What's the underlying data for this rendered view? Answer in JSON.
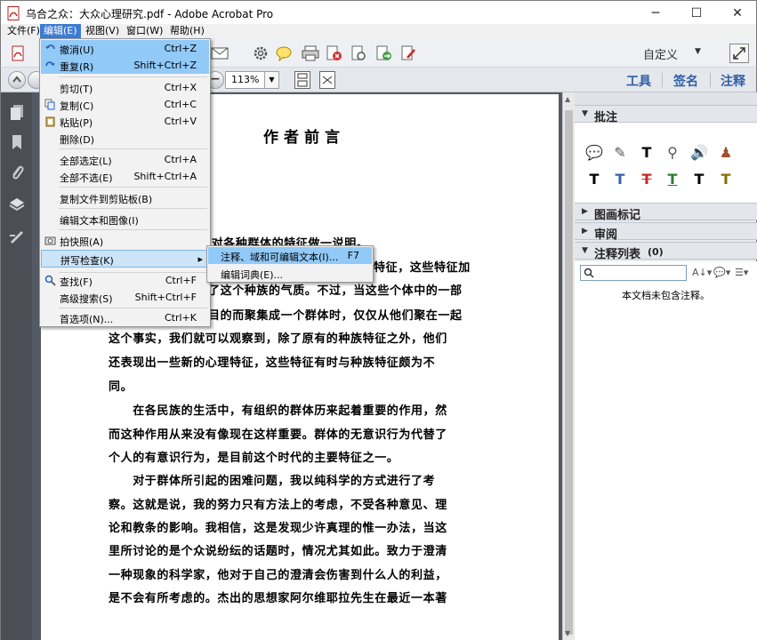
{
  "window": {
    "title": "乌合之众：大众心理研究.pdf - Adobe Acrobat Pro",
    "minimize": "─",
    "maximize": "☐",
    "close": "✕"
  },
  "menubar": {
    "items": [
      {
        "label": "文件(F)"
      },
      {
        "label": "编辑(E)"
      },
      {
        "label": "视图(V)"
      },
      {
        "label": "窗口(W)"
      },
      {
        "label": "帮助(H)"
      }
    ]
  },
  "toolbar": {
    "custom_label": "自定义",
    "zoom": "113%",
    "tabs": [
      "工具",
      "签名",
      "注释"
    ]
  },
  "edit_menu": {
    "items": [
      {
        "label": "撤消(U)",
        "shortcut": "Ctrl+Z"
      },
      {
        "label": "重复(R)",
        "shortcut": "Shift+Ctrl+Z"
      },
      {
        "label": "剪切(T)",
        "shortcut": "Ctrl+X"
      },
      {
        "label": "复制(C)",
        "shortcut": "Ctrl+C"
      },
      {
        "label": "粘贴(P)",
        "shortcut": "Ctrl+V"
      },
      {
        "label": "删除(D)",
        "shortcut": ""
      },
      {
        "label": "全部选定(L)",
        "shortcut": "Ctrl+A"
      },
      {
        "label": "全部不选(E)",
        "shortcut": "Shift+Ctrl+A"
      },
      {
        "label": "复制文件到剪贴板(B)",
        "shortcut": ""
      },
      {
        "label": "编辑文本和图像(I)",
        "shortcut": ""
      },
      {
        "label": "拍快照(A)",
        "shortcut": ""
      },
      {
        "label": "拼写检查(K)",
        "shortcut": "▸"
      },
      {
        "label": "查找(F)",
        "shortcut": "Ctrl+F"
      },
      {
        "label": "高级搜索(S)",
        "shortcut": "Shift+Ctrl+F"
      },
      {
        "label": "首选项(N)...",
        "shortcut": "Ctrl+K"
      }
    ],
    "submenu": [
      {
        "label": "注释、域和可编辑文本(I)...",
        "shortcut": "F7"
      },
      {
        "label": "编辑词典(E)...",
        "shortcut": ""
      }
    ]
  },
  "document": {
    "heading": "作者前言",
    "lines": [
      "要对各种群体的特征做一说明。",
      "特征，这些特征加",
      "了这个种族的气质。不过，当这些个体中的一部",
      "目的而聚集成一个群体时，仅仅从他们聚在一起",
      "这个事实，我们就可以观察到，除了原有的种族特征之外，他们",
      "还表现出一些新的心理特征，这些特征有时与种族特征颇为不",
      "同。",
      "　　在各民族的生活中，有组织的群体历来起着重要的作用，然",
      "而这种作用从来没有像现在这样重要。群体的无意识行为代替了",
      "个人的有意识行为，是目前这个时代的主要特征之一。",
      "　　对于群体所引起的困难问题，我以纯科学的方式进行了考",
      "察。这就是说，我的努力只有方法上的考虑，不受各种意见、理",
      "论和教条的影响。我相信，这是发现少许真理的惟一办法，当这",
      "里所讨论的是个众说纷纭的话题时，情况尤其如此。致力于澄清",
      "一种现象的科学家，他对于自己的澄清会伤害到什么人的利益，",
      "是不会有所考虑的。杰出的思想家阿尔维耶拉先生在最近一本著"
    ]
  },
  "right_panel": {
    "sections": [
      "批注",
      "图画标记",
      "审阅",
      "注释列表"
    ],
    "comment_count": "(0)",
    "empty_message": "本文档未包含注释。"
  },
  "colors": {
    "menu_highlight": "#3d7bd1",
    "item_highlight": "#91c9f7",
    "doc_background": "#535a63",
    "tab_blue": "#2f5ea8"
  }
}
